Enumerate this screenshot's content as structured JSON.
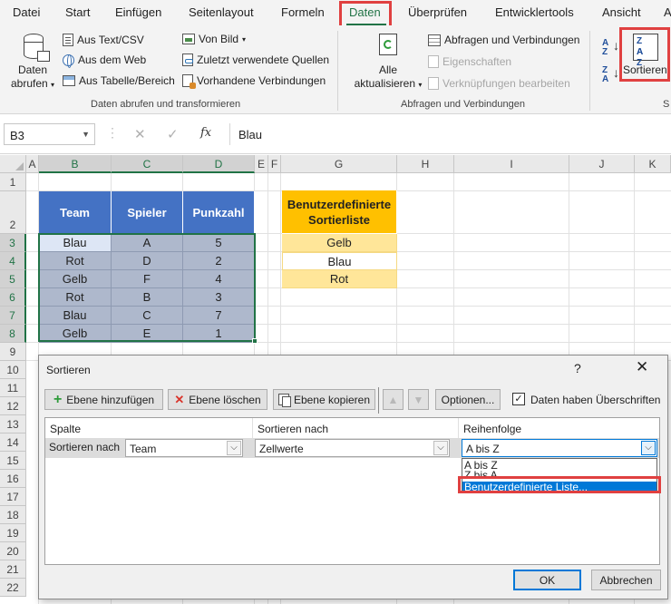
{
  "ribbon": {
    "tabs": [
      "Datei",
      "Start",
      "Einfügen",
      "Seitenlayout",
      "Formeln",
      "Daten",
      "Überprüfen",
      "Entwicklertools",
      "Ansicht",
      "A"
    ],
    "active_tab": "Daten",
    "get_transform": {
      "big_button": [
        "Daten",
        "abrufen"
      ],
      "buttons": [
        "Aus Text/CSV",
        "Aus dem Web",
        "Aus Tabelle/Bereich",
        "Von Bild",
        "Zuletzt verwendete Quellen",
        "Vorhandene Verbindungen"
      ],
      "label": "Daten abrufen und transformieren"
    },
    "queries": {
      "big_button": [
        "Alle",
        "aktualisieren"
      ],
      "buttons": [
        "Abfragen und Verbindungen",
        "Eigenschaften",
        "Verknüpfungen bearbeiten"
      ],
      "label": "Abfragen und Verbindungen"
    },
    "sort": {
      "az_top": "A",
      "az_bottom": "Z",
      "za_top": "Z",
      "za_bottom": "A",
      "big_top": "Z A",
      "big_bottom": "A Z",
      "label": "Sortieren",
      "group_label_partial": "S"
    }
  },
  "formula_bar": {
    "name_box": "B3",
    "cancel_icon": "✕",
    "enter_icon": "✓",
    "fx": "fx",
    "value": "Blau"
  },
  "grid": {
    "columns": [
      "A",
      "B",
      "C",
      "D",
      "E",
      "F",
      "G",
      "H",
      "I",
      "J",
      "K"
    ],
    "rows": [
      "1",
      "2",
      "3",
      "4",
      "5",
      "6",
      "7",
      "8",
      "9",
      "10",
      "11",
      "12",
      "13",
      "14",
      "15",
      "16",
      "17",
      "18",
      "19",
      "20",
      "21",
      "22"
    ]
  },
  "table": {
    "headers": [
      "Team",
      "Spieler",
      "Punkzahl"
    ],
    "rows": [
      [
        "Blau",
        "A",
        "5"
      ],
      [
        "Rot",
        "D",
        "2"
      ],
      [
        "Gelb",
        "F",
        "4"
      ],
      [
        "Rot",
        "B",
        "3"
      ],
      [
        "Blau",
        "C",
        "7"
      ],
      [
        "Gelb",
        "E",
        "1"
      ]
    ]
  },
  "custom_list": {
    "header": [
      "Benutzerdefinierte",
      "Sortierliste"
    ],
    "items": [
      "Gelb",
      "Blau",
      "Rot"
    ]
  },
  "dialog": {
    "title": "Sortieren",
    "help": "?",
    "close": "✕",
    "toolbar": {
      "add_level": "Ebene hinzufügen",
      "delete_level": "Ebene löschen",
      "copy_level": "Ebene kopieren",
      "move_up": "▲",
      "move_down": "▼",
      "options": "Optionen...",
      "has_headers": "Daten haben Überschriften",
      "has_headers_checked": "✓"
    },
    "columns": [
      "Spalte",
      "Sortieren nach",
      "Reihenfolge"
    ],
    "level": {
      "row_label": "Sortieren nach",
      "column": "Team",
      "sort_on": "Zellwerte",
      "order": "A bis Z"
    },
    "dropdown_options": [
      "A bis Z",
      "Z bis A",
      "Benutzerdefinierte Liste..."
    ],
    "dropdown_selected": "Benutzerdefinierte Liste...",
    "ok": "OK",
    "cancel": "Abbrechen"
  }
}
